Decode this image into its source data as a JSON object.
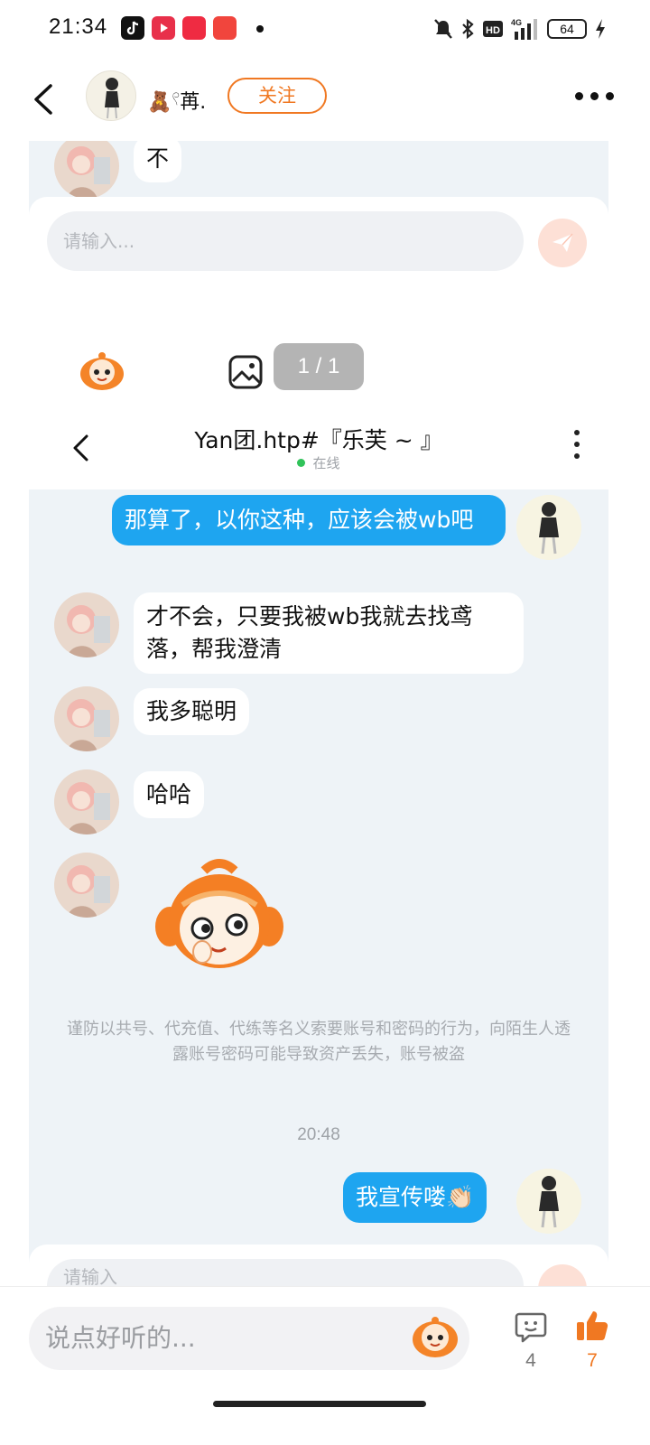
{
  "status_bar": {
    "time": "21:34",
    "battery": "64",
    "network": "4G",
    "indicators": [
      "tiktok-app-icon",
      "video-app-icon",
      "xiaohongshu-app-icon",
      "toutiao-app-icon",
      "mute-bell-icon",
      "bluetooth-icon",
      "hd-icon",
      "signal-icon",
      "charging-icon"
    ]
  },
  "header": {
    "username": "🧸𓍢苒.",
    "follow_label": "关注"
  },
  "screenshot": {
    "top_message": "不",
    "input_placeholder": "请输入...",
    "page_indicator": "1 / 1",
    "chat_title": "Yan团.htp#『乐芙 ~ 』",
    "online_status": "在线",
    "messages": [
      {
        "side": "right",
        "text": "那算了，以你这种，应该会被wb吧"
      },
      {
        "side": "left",
        "text": "才不会，只要我被wb我就去找鸢落，帮我澄清"
      },
      {
        "side": "left",
        "text": "我多聪明"
      },
      {
        "side": "left",
        "text": "哈哈"
      },
      {
        "side": "left",
        "type": "sticker",
        "sticker": "orange-monkey-sticker"
      }
    ],
    "warning": "谨防以共号、代充值、代练等名义索要账号和密码的行为，向陌生人透露账号密码可能导致资产丢失，账号被盗",
    "timestamp": "20:48",
    "last_message": "我宣传喽👏🏻",
    "bottom_input_placeholder": "请输入"
  },
  "bottom_bar": {
    "comment_placeholder": "说点好听的...",
    "comment_count": "4",
    "like_count": "7"
  },
  "colors": {
    "accent_orange": "#f07822",
    "bubble_blue": "#1ea5f0",
    "chat_background": "#eef3f7"
  }
}
